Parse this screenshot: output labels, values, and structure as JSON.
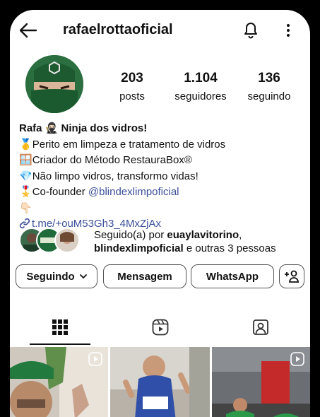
{
  "header": {
    "username": "rafaelrottaoficial",
    "back_icon": "arrow-left-icon",
    "notification_icon": "bell-icon",
    "menu_icon": "more-vertical-icon"
  },
  "stats": [
    {
      "value": "203",
      "label": "posts"
    },
    {
      "value": "1.104",
      "label": "seguidores"
    },
    {
      "value": "136",
      "label": "seguindo"
    }
  ],
  "bio": {
    "name": "Rafa",
    "name_emoji": "🥷🏻",
    "tagline": "Ninja dos vidros!",
    "line1_emoji": "🥇",
    "line1": "Perito em limpeza e tratamento de vidros",
    "line2_emoji": "🪟",
    "line2": "Criador do Método RestauraBox®",
    "line3_emoji": "💎",
    "line3": "Não limpo vidros, transformo vidas!",
    "line4_emoji": "🎖️",
    "line4_prefix": "Co-founder ",
    "line4_mention": "@blindexlimpoficial",
    "line5_emoji": "👇🏻",
    "link_icon": "link-icon",
    "link": "t.me/+ouM53Gh3_4MxZjAx"
  },
  "followed_by": {
    "prefix": "Seguido(a) por ",
    "user1": "euaylavitorino",
    "sep": ",",
    "user2": "blindexlimpoficial",
    "suffix": " e outras 3 pessoas"
  },
  "buttons": {
    "following": "Seguindo",
    "message": "Mensagem",
    "whatsapp": "WhatsApp",
    "add_person_icon": "add-person-icon"
  },
  "tabs": [
    {
      "name": "grid",
      "icon": "grid-icon",
      "active": true
    },
    {
      "name": "reels",
      "icon": "reels-icon",
      "active": false
    },
    {
      "name": "tagged",
      "icon": "tagged-person-icon",
      "active": false
    }
  ],
  "colors": {
    "accent_link": "#3a4f9a",
    "avatar_green": "#1f6b3a"
  }
}
